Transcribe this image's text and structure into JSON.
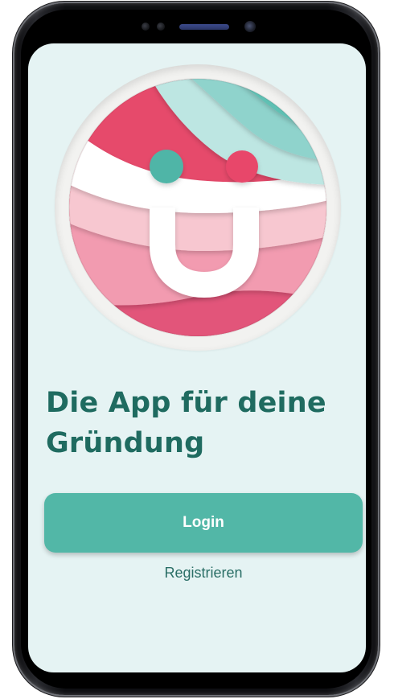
{
  "onboarding": {
    "headline": "Die App für deine Gründung",
    "login_label": "Login",
    "register_label": "Registrieren"
  },
  "colors": {
    "screen_background": "#e5f3f3",
    "headline": "#1f6b60",
    "primary_button": "#52b7a7",
    "logo_teal": "#4fb5a7",
    "logo_pink": "#e8466b"
  },
  "icons": {
    "logo": "smiley-u-logo-icon",
    "speaker": "speaker-grille-icon",
    "camera": "front-camera-icon"
  }
}
